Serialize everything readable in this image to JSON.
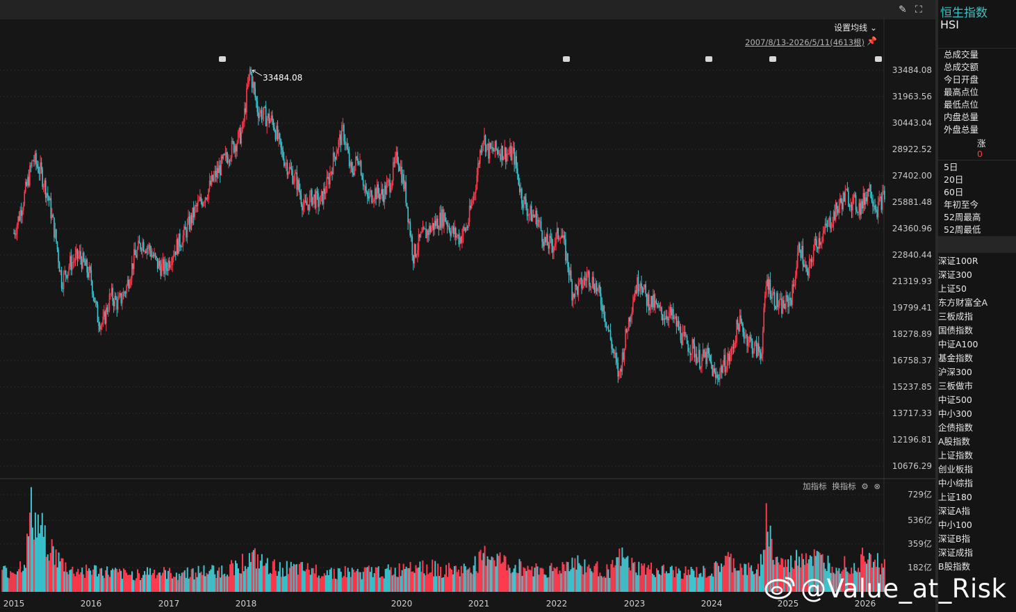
{
  "header": {
    "ma_setting": "设置均线",
    "range_text": "2007/8/13-2026/5/11(4613根)"
  },
  "volume_toolbar": {
    "add_indicator": "加指标",
    "switch_indicator": "换指标"
  },
  "side_panel": {
    "name": "恒生指数",
    "code": "HSI",
    "stats": [
      "总成交量",
      "总成交额",
      "今日开盘",
      "最高点位",
      "最低点位",
      "内盘总量",
      "外盘总量"
    ],
    "rise_label": "涨",
    "rise_value": "0",
    "periods": [
      "5日",
      "20日",
      "60日",
      "年初至今",
      "52周最高",
      "52周最低"
    ],
    "indices": [
      "深证100R",
      "深证300",
      "上证50",
      "东方财富全A",
      "三板成指",
      "国债指数",
      "中证A100",
      "基金指数",
      "沪深300",
      "三板做市",
      "中证500",
      "中小300",
      "企债指数",
      "A股指数",
      "上证指数",
      "创业板指",
      "中小综指",
      "上证180",
      "深证A指",
      "中小100",
      "深证B指",
      "深证成指",
      "B股指数"
    ]
  },
  "watermark": "@Value_at_Risk",
  "colors": {
    "up": "#ff3b4f",
    "down": "#3ec6d0",
    "accent": "#3fc2c6",
    "ma": "#e8c23a"
  },
  "chart_data": [
    {
      "type": "candlestick",
      "title": "",
      "x_ticks": [
        "2015",
        "2016",
        "2017",
        "2018",
        "2020",
        "2021",
        "2022",
        "2023",
        "2024",
        "2025",
        "2026"
      ],
      "y_ticks": [
        "33484.08",
        "31963.56",
        "30443.04",
        "28922.52",
        "27402.00",
        "25881.48",
        "24360.96",
        "22840.44",
        "21319.93",
        "19799.41",
        "18278.89",
        "16758.37",
        "15237.85",
        "13717.33",
        "12196.81",
        "10676.29"
      ],
      "ylim": [
        10000,
        34000
      ],
      "max_annotation": {
        "date": "2018.08",
        "value": "33484.08"
      },
      "series": [
        {
          "values": [
            [
              "2015.00",
              24100
            ],
            [
              "2015.05",
              24800
            ],
            [
              "2015.15",
              26500
            ],
            [
              "2015.25",
              28400
            ],
            [
              "2015.35",
              27600
            ],
            [
              "2015.45",
              26100
            ],
            [
              "2015.55",
              23600
            ],
            [
              "2015.62",
              21300
            ],
            [
              "2015.72",
              22300
            ],
            [
              "2015.85",
              22800
            ],
            [
              "2016.00",
              21500
            ],
            [
              "2016.08",
              19300
            ],
            [
              "2016.15",
              18800
            ],
            [
              "2016.25",
              20500
            ],
            [
              "2016.35",
              20000
            ],
            [
              "2016.45",
              20900
            ],
            [
              "2016.55",
              22600
            ],
            [
              "2016.65",
              23600
            ],
            [
              "2016.75",
              23200
            ],
            [
              "2016.85",
              22300
            ],
            [
              "2016.95",
              22000
            ],
            [
              "2017.05",
              23000
            ],
            [
              "2017.20",
              24000
            ],
            [
              "2017.35",
              25500
            ],
            [
              "2017.50",
              26500
            ],
            [
              "2017.60",
              27400
            ],
            [
              "2017.75",
              28500
            ],
            [
              "2017.85",
              29200
            ],
            [
              "2017.95",
              29900
            ],
            [
              "2018.05",
              33484
            ],
            [
              "2018.15",
              31200
            ],
            [
              "2018.25",
              30800
            ],
            [
              "2018.35",
              30500
            ],
            [
              "2018.45",
              28800
            ],
            [
              "2018.55",
              27800
            ],
            [
              "2018.65",
              27100
            ],
            [
              "2018.75",
              25500
            ],
            [
              "2018.85",
              26200
            ],
            [
              "2018.95",
              25800
            ],
            [
              "2019.05",
              27000
            ],
            [
              "2019.15",
              28800
            ],
            [
              "2019.25",
              30000
            ],
            [
              "2019.35",
              27500
            ],
            [
              "2019.45",
              28600
            ],
            [
              "2019.55",
              26000
            ],
            [
              "2019.65",
              26500
            ],
            [
              "2019.75",
              26300
            ],
            [
              "2019.85",
              27000
            ],
            [
              "2019.95",
              28600
            ],
            [
              "2020.05",
              26400
            ],
            [
              "2020.15",
              22800
            ],
            [
              "2020.25",
              23800
            ],
            [
              "2020.40",
              24500
            ],
            [
              "2020.55",
              25100
            ],
            [
              "2020.65",
              24200
            ],
            [
              "2020.75",
              23800
            ],
            [
              "2020.85",
              24500
            ],
            [
              "2020.95",
              26700
            ],
            [
              "2021.05",
              29800
            ],
            [
              "2021.12",
              28800
            ],
            [
              "2021.25",
              28900
            ],
            [
              "2021.35",
              28700
            ],
            [
              "2021.45",
              28600
            ],
            [
              "2021.55",
              26200
            ],
            [
              "2021.65",
              25200
            ],
            [
              "2021.75",
              25000
            ],
            [
              "2021.85",
              23500
            ],
            [
              "2021.95",
              23400
            ],
            [
              "2022.05",
              24300
            ],
            [
              "2022.15",
              22200
            ],
            [
              "2022.20",
              20700
            ],
            [
              "2022.30",
              21000
            ],
            [
              "2022.40",
              21700
            ],
            [
              "2022.50",
              21100
            ],
            [
              "2022.60",
              19800
            ],
            [
              "2022.70",
              17800
            ],
            [
              "2022.80",
              15800
            ],
            [
              "2022.90",
              18500
            ],
            [
              "2023.00",
              20800
            ],
            [
              "2023.08",
              21500
            ],
            [
              "2023.15",
              20300
            ],
            [
              "2023.25",
              20000
            ],
            [
              "2023.35",
              19400
            ],
            [
              "2023.45",
              19500
            ],
            [
              "2023.55",
              18800
            ],
            [
              "2023.65",
              17800
            ],
            [
              "2023.75",
              17500
            ],
            [
              "2023.85",
              16800
            ],
            [
              "2023.95",
              17000
            ],
            [
              "2024.05",
              15700
            ],
            [
              "2024.15",
              16500
            ],
            [
              "2024.25",
              17000
            ],
            [
              "2024.35",
              19000
            ],
            [
              "2024.45",
              18200
            ],
            [
              "2024.55",
              17500
            ],
            [
              "2024.65",
              17200
            ],
            [
              "2024.72",
              21500
            ],
            [
              "2024.80",
              20500
            ],
            [
              "2024.90",
              19800
            ],
            [
              "2024.97",
              20000
            ],
            [
              "2025.05",
              20500
            ],
            [
              "2025.15",
              23500
            ],
            [
              "2025.25",
              21500
            ],
            [
              "2025.35",
              23500
            ],
            [
              "2025.45",
              24000
            ],
            [
              "2025.55",
              24800
            ],
            [
              "2025.65",
              25600
            ],
            [
              "2025.75",
              26300
            ],
            [
              "2025.85",
              25800
            ],
            [
              "2025.95",
              25600
            ],
            [
              "2026.05",
              26800
            ],
            [
              "2026.15",
              25500
            ],
            [
              "2026.25",
              26300
            ]
          ]
        }
      ]
    },
    {
      "type": "bar",
      "title": "",
      "y_ticks": [
        "729亿",
        "536亿",
        "359亿",
        "182亿"
      ],
      "ylim": [
        0,
        800
      ],
      "series": [
        {
          "values": [
            [
              "2015.00",
              160
            ],
            [
              "2015.15",
              240
            ],
            [
              "2015.22",
              620
            ],
            [
              "2015.30",
              520
            ],
            [
              "2015.42",
              420
            ],
            [
              "2015.55",
              260
            ],
            [
              "2015.75",
              160
            ],
            [
              "2016.00",
              170
            ],
            [
              "2016.25",
              150
            ],
            [
              "2016.50",
              130
            ],
            [
              "2016.75",
              160
            ],
            [
              "2017.00",
              140
            ],
            [
              "2017.25",
              150
            ],
            [
              "2017.50",
              160
            ],
            [
              "2017.75",
              170
            ],
            [
              "2017.95",
              230
            ],
            [
              "2018.10",
              260
            ],
            [
              "2018.30",
              190
            ],
            [
              "2018.55",
              180
            ],
            [
              "2018.80",
              170
            ],
            [
              "2019.05",
              160
            ],
            [
              "2019.40",
              150
            ],
            [
              "2019.70",
              160
            ],
            [
              "2019.95",
              160
            ],
            [
              "2020.10",
              240
            ],
            [
              "2020.25",
              210
            ],
            [
              "2020.50",
              170
            ],
            [
              "2020.80",
              170
            ],
            [
              "2021.00",
              230
            ],
            [
              "2021.12",
              300
            ],
            [
              "2021.40",
              200
            ],
            [
              "2021.75",
              180
            ],
            [
              "2022.00",
              170
            ],
            [
              "2022.20",
              240
            ],
            [
              "2022.45",
              180
            ],
            [
              "2022.70",
              170
            ],
            [
              "2022.82",
              270
            ],
            [
              "2023.00",
              190
            ],
            [
              "2023.35",
              160
            ],
            [
              "2023.70",
              150
            ],
            [
              "2024.00",
              150
            ],
            [
              "2024.20",
              250
            ],
            [
              "2024.45",
              170
            ],
            [
              "2024.62",
              170
            ],
            [
              "2024.72",
              560
            ],
            [
              "2024.82",
              260
            ],
            [
              "2025.00",
              200
            ],
            [
              "2025.20",
              300
            ],
            [
              "2025.35",
              260
            ],
            [
              "2025.55",
              220
            ],
            [
              "2025.75",
              230
            ],
            [
              "2025.92",
              200
            ],
            [
              "2026.00",
              360
            ],
            [
              "2026.20",
              200
            ]
          ]
        }
      ]
    }
  ]
}
